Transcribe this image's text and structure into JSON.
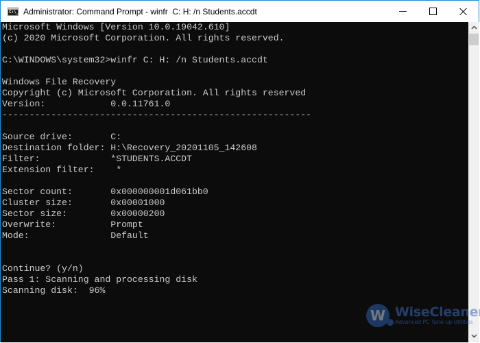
{
  "window": {
    "title": "Administrator: Command Prompt - winfr  C: H: /n Students.accdt",
    "app_icon_text": "C:\\_",
    "controls": {
      "minimize": "minimize",
      "maximize": "maximize",
      "close": "close"
    }
  },
  "console": {
    "lines": [
      "Microsoft Windows [Version 10.0.19042.610]",
      "(c) 2020 Microsoft Corporation. All rights reserved.",
      "",
      "C:\\WINDOWS\\system32>winfr C: H: /n Students.accdt",
      "",
      "Windows File Recovery",
      "Copyright (c) Microsoft Corporation. All rights reserved",
      "Version:            0.0.11761.0",
      "---------------------------------------------------------",
      "",
      "Source drive:       C:",
      "Destination folder: H:\\Recovery_20201105_142608",
      "Filter:             *STUDENTS.ACCDT",
      "Extension filter:    *",
      "",
      "Sector count:       0x000000001d061bb0",
      "Cluster size:       0x00001000",
      "Sector size:        0x00000200",
      "Overwrite:          Prompt",
      "Mode:               Default",
      "",
      "",
      "Continue? (y/n)",
      "Pass 1: Scanning and processing disk",
      "Scanning disk:  96%"
    ]
  },
  "scan": {
    "progress_percent": 96
  },
  "scrollbar": {
    "up_glyph": "⌃",
    "down_glyph": "⌄"
  },
  "watermark": {
    "logo_letter": "W",
    "brand": "WiseCleaner",
    "tagline": "Advanced PC Tune-up Utilities"
  }
}
